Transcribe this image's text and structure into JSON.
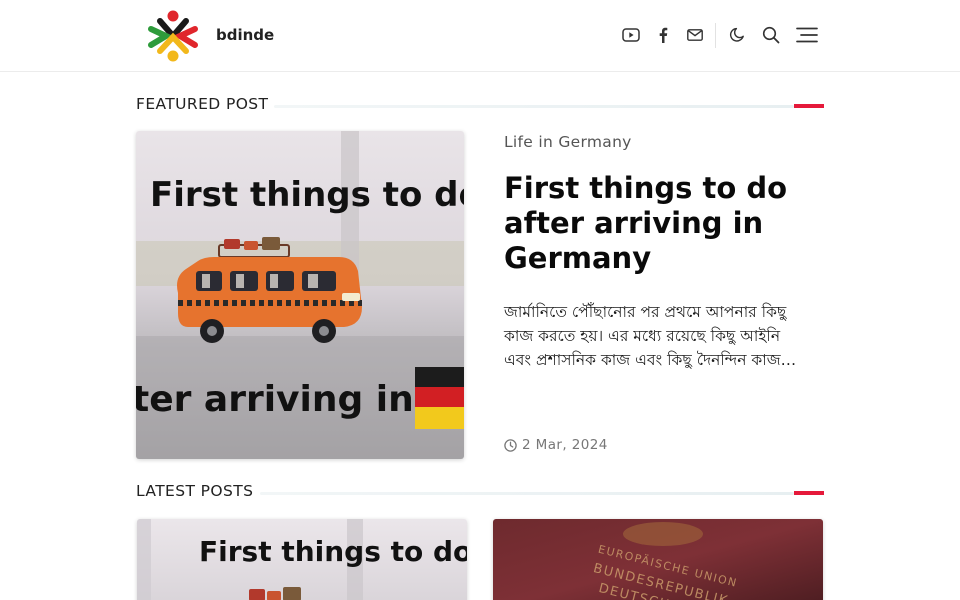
{
  "header": {
    "site_name": "bdinde",
    "icons": [
      "logo-icon",
      "youtube-icon",
      "facebook-icon",
      "mail-icon",
      "moon-icon",
      "search-icon",
      "menu-icon"
    ]
  },
  "featured": {
    "section_title": "FEATURED POST",
    "category": "Life in Germany",
    "title": "First things to do after arriving in Germany",
    "excerpt": "জার্মানিতে পৌঁছানোর পর প্রথমে আপনার কিছু কাজ করতে হয়। এর মধ্যে রয়েছে কিছু আইনি এবং প্রশাসনিক কাজ এবং কিছু দৈনন্দিন কাজ…",
    "date": "2 Mar, 2024",
    "image_text_top": "First things to do",
    "image_text_bottom": "ter arriving in"
  },
  "latest": {
    "section_title": "LATEST POSTS",
    "cards": [
      {
        "image_text": "First things to do"
      },
      {
        "image_text_1": "EUROPÄISCHE UNION",
        "image_text_2": "BUNDESREPUBLIK",
        "image_text_3": "DEUTSCHLAND"
      }
    ]
  },
  "colors": {
    "accent": "#e5193a",
    "divider": "#ececec",
    "text": "#111111",
    "muted": "#777777"
  }
}
